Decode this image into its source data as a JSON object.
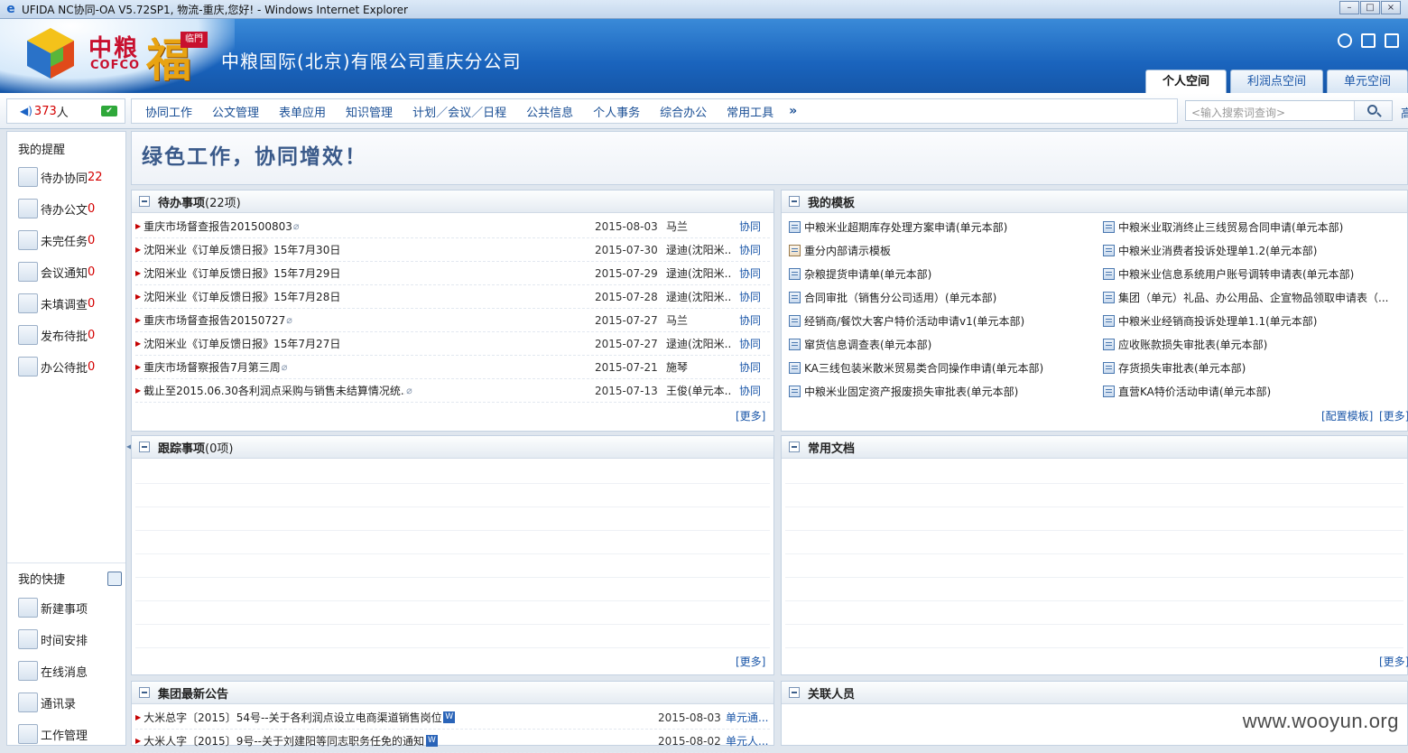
{
  "window": {
    "title": "UFIDA NC协同-OA V5.72SP1, 物流-重庆,您好! - Windows Internet Explorer"
  },
  "header": {
    "logo_cn": "中粮",
    "logo_en": "COFCO",
    "fu_char": "福",
    "fu_seal": "临門",
    "company": "中粮国际(北京)有限公司重庆分公司",
    "space_tabs": [
      "个人空间",
      "利润点空间",
      "单元空间"
    ]
  },
  "nav": {
    "online_count": "373",
    "online_unit": "人",
    "menu": [
      "协同工作",
      "公文管理",
      "表单应用",
      "知识管理",
      "计划／会议／日程",
      "公共信息",
      "个人事务",
      "综合办公",
      "常用工具"
    ],
    "more": "»",
    "search_placeholder": "<输入搜索词查询>",
    "extra": "高"
  },
  "sidebar": {
    "reminders_title": "我的提醒",
    "reminders": [
      {
        "label": "待办协同",
        "count": "22"
      },
      {
        "label": "待办公文",
        "count": "0"
      },
      {
        "label": "未完任务",
        "count": "0"
      },
      {
        "label": "会议通知",
        "count": "0"
      },
      {
        "label": "未填调查",
        "count": "0"
      },
      {
        "label": "发布待批",
        "count": "0"
      },
      {
        "label": "办公待批",
        "count": "0"
      }
    ],
    "shortcuts_title": "我的快捷",
    "shortcuts": [
      "新建事项",
      "时间安排",
      "在线消息",
      "通讯录",
      "工作管理"
    ]
  },
  "banner": {
    "slogan": "绿色工作，协同增效！"
  },
  "todo": {
    "title": "待办事项",
    "count": "(22项)",
    "more": "[更多]",
    "rows": [
      {
        "title": "重庆市场督查报告201500803",
        "clip": true,
        "date": "2015-08-03",
        "person": "马兰",
        "type": "协同"
      },
      {
        "title": "沈阳米业《订单反馈日报》15年7月30日",
        "clip": false,
        "date": "2015-07-30",
        "person": "逯迪(沈阳米...",
        "type": "协同"
      },
      {
        "title": "沈阳米业《订单反馈日报》15年7月29日",
        "clip": false,
        "date": "2015-07-29",
        "person": "逯迪(沈阳米...",
        "type": "协同"
      },
      {
        "title": "沈阳米业《订单反馈日报》15年7月28日",
        "clip": false,
        "date": "2015-07-28",
        "person": "逯迪(沈阳米...",
        "type": "协同"
      },
      {
        "title": "重庆市场督查报告20150727",
        "clip": true,
        "date": "2015-07-27",
        "person": "马兰",
        "type": "协同"
      },
      {
        "title": "沈阳米业《订单反馈日报》15年7月27日",
        "clip": false,
        "date": "2015-07-27",
        "person": "逯迪(沈阳米...",
        "type": "协同"
      },
      {
        "title": "重庆市场督察报告7月第三周",
        "clip": true,
        "date": "2015-07-21",
        "person": "施琴",
        "type": "协同"
      },
      {
        "title": "截止至2015.06.30各利润点采购与销售未结算情况统...",
        "clip": true,
        "date": "2015-07-13",
        "person": "王俊(单元本...",
        "type": "协同"
      }
    ]
  },
  "templates": {
    "title": "我的模板",
    "config": "[配置模板]",
    "more": "[更多]",
    "left": [
      "中粮米业超期库存处理方案申请(单元本部)",
      "重分内部请示模板",
      "杂粮提货申请单(单元本部)",
      "合同审批（销售分公司适用）(单元本部)",
      "经销商/餐饮大客户特价活动申请v1(单元本部)",
      "窜货信息调查表(单元本部)",
      "KA三线包装米散米贸易类合同操作申请(单元本部)",
      "中粮米业固定资产报废损失审批表(单元本部)"
    ],
    "right": [
      "中粮米业取消终止三线贸易合同申请(单元本部)",
      "中粮米业消费者投诉处理单1.2(单元本部)",
      "中粮米业信息系统用户账号调转申请表(单元本部)",
      "集团（单元）礼品、办公用品、企宣物品领取申请表（...",
      "中粮米业经销商投诉处理单1.1(单元本部)",
      "应收账款损失审批表(单元本部)",
      "存货损失审批表(单元本部)",
      "直营KA特价活动申请(单元本部)"
    ]
  },
  "tracking": {
    "title": "跟踪事项",
    "count": "(0项)",
    "more": "[更多]"
  },
  "docs": {
    "title": "常用文档",
    "more": "[更多]"
  },
  "notices": {
    "title": "集团最新公告",
    "rows": [
      {
        "title": "大米总字〔2015〕54号--关于各利润点设立电商渠道销售岗位...",
        "date": "2015-08-03",
        "source": "单元通..."
      },
      {
        "title": "大米人字〔2015〕9号--关于刘建阳等同志职务任免的通知",
        "date": "2015-08-02",
        "source": "单元人..."
      }
    ]
  },
  "people": {
    "title": "关联人员"
  },
  "watermark": "www.wooyun.org"
}
